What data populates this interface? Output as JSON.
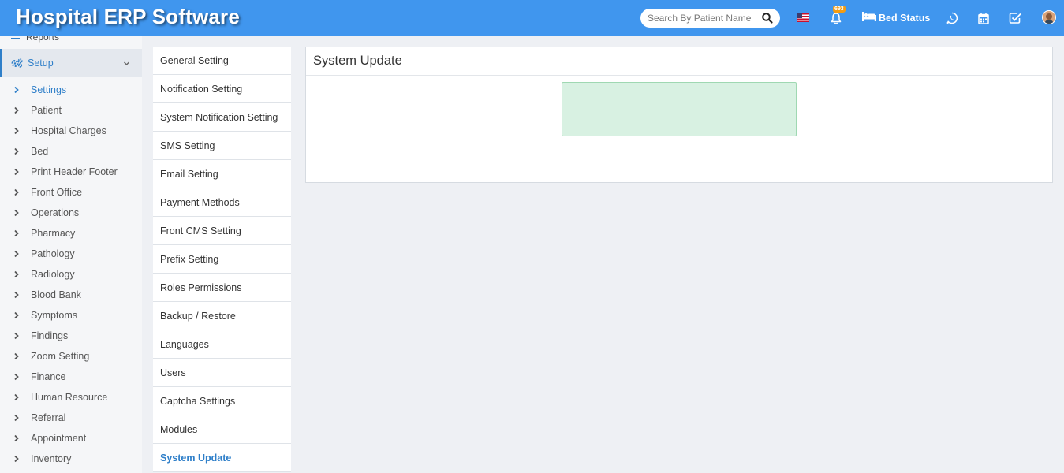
{
  "header": {
    "brand": "Hospital ERP Software",
    "search_placeholder": "Search By Patient Name",
    "notification_count": "693",
    "bed_status_label": "Bed Status",
    "icons": [
      "search-icon",
      "us-flag-icon",
      "bell-icon",
      "bed-icon",
      "whatsapp-icon",
      "calendar-icon",
      "check-square-icon",
      "user-avatar"
    ],
    "colors": {
      "topbar": "#4096ee",
      "accent": "#2f7fc9",
      "badge": "#f39c12"
    }
  },
  "sidebar": {
    "previous_item": "Reports",
    "section": "Setup",
    "items": [
      {
        "label": "Settings",
        "active": true
      },
      {
        "label": "Patient"
      },
      {
        "label": "Hospital Charges"
      },
      {
        "label": "Bed"
      },
      {
        "label": "Print Header Footer"
      },
      {
        "label": "Front Office"
      },
      {
        "label": "Operations"
      },
      {
        "label": "Pharmacy"
      },
      {
        "label": "Pathology"
      },
      {
        "label": "Radiology"
      },
      {
        "label": "Blood Bank"
      },
      {
        "label": "Symptoms"
      },
      {
        "label": "Findings"
      },
      {
        "label": "Zoom Setting"
      },
      {
        "label": "Finance"
      },
      {
        "label": "Human Resource"
      },
      {
        "label": "Referral"
      },
      {
        "label": "Appointment"
      },
      {
        "label": "Inventory"
      }
    ]
  },
  "settings_menu": {
    "items": [
      {
        "label": "General Setting"
      },
      {
        "label": "Notification Setting"
      },
      {
        "label": "System Notification Setting"
      },
      {
        "label": "SMS Setting"
      },
      {
        "label": "Email Setting"
      },
      {
        "label": "Payment Methods"
      },
      {
        "label": "Front CMS Setting"
      },
      {
        "label": "Prefix Setting"
      },
      {
        "label": "Roles Permissions"
      },
      {
        "label": "Backup / Restore"
      },
      {
        "label": "Languages"
      },
      {
        "label": "Users"
      },
      {
        "label": "Captcha Settings"
      },
      {
        "label": "Modules"
      },
      {
        "label": "System Update",
        "active": true
      }
    ]
  },
  "panel": {
    "title": "System Update"
  }
}
